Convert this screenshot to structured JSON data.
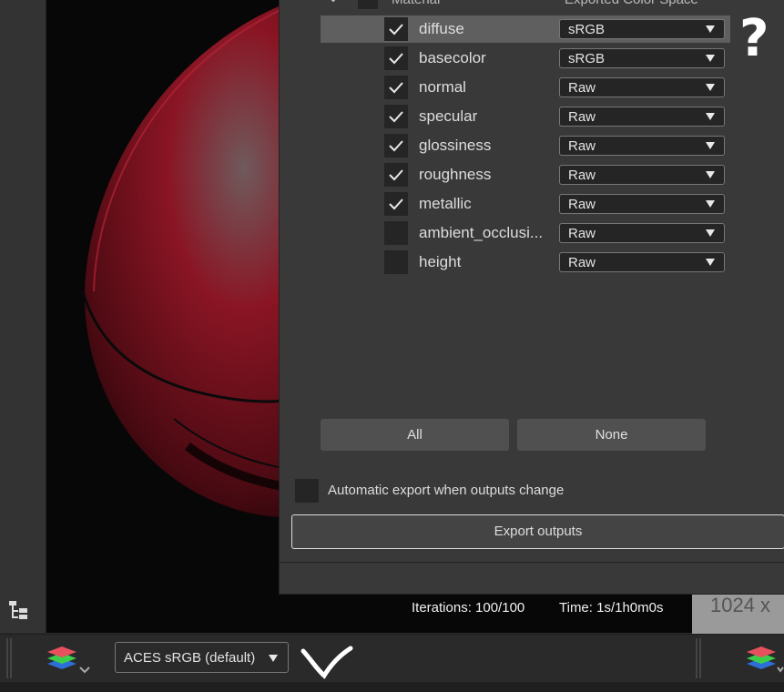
{
  "viewport": {
    "iterations_text": "Iterations: 100/100",
    "time_text": "Time: 1s/1h0m0s"
  },
  "resolution_text": "1024 x",
  "dialog": {
    "header_material": "Material",
    "header_color_space": "Exported Color Space",
    "rows": [
      {
        "label": "diffuse",
        "checked": true,
        "space": "sRGB"
      },
      {
        "label": "basecolor",
        "checked": true,
        "space": "sRGB"
      },
      {
        "label": "normal",
        "checked": true,
        "space": "Raw"
      },
      {
        "label": "specular",
        "checked": true,
        "space": "Raw"
      },
      {
        "label": "glossiness",
        "checked": true,
        "space": "Raw"
      },
      {
        "label": "roughness",
        "checked": true,
        "space": "Raw"
      },
      {
        "label": "metallic",
        "checked": true,
        "space": "Raw"
      },
      {
        "label": "ambient_occlusi...",
        "checked": false,
        "space": "Raw"
      },
      {
        "label": "height",
        "checked": false,
        "space": "Raw"
      }
    ],
    "all_label": "All",
    "none_label": "None",
    "auto_export_label": "Automatic export when outputs change",
    "auto_export_checked": false,
    "export_label": "Export outputs"
  },
  "annotations": {
    "question_mark": "?"
  },
  "toolbar": {
    "color_space_value": "ACES sRGB (default)"
  },
  "colors": {
    "dialog_bg": "#393939",
    "selected_row": "#5f5f5f",
    "sphere_red": "#8a1524"
  }
}
